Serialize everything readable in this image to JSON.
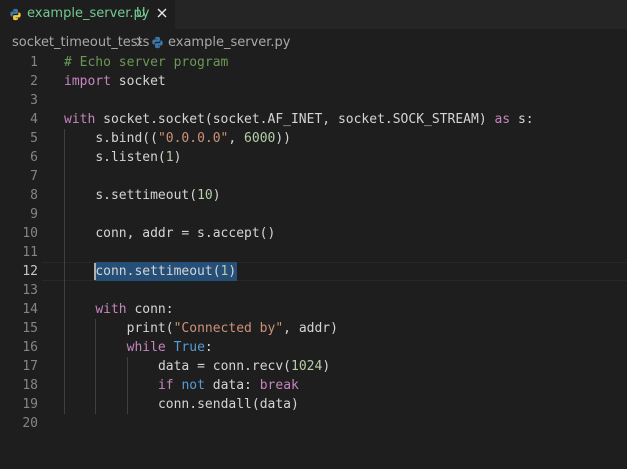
{
  "colors": {
    "editor_background": "#1e1e1e",
    "tab_label_untracked": "#73c991",
    "comment": "#6a9955",
    "keyword": "#c586c0",
    "constant": "#569cd6",
    "string": "#ce9178",
    "number": "#b5cea8",
    "selection": "#264f78"
  },
  "tab": {
    "label": "example_server.py",
    "status": "U",
    "icon": "python-file-icon",
    "close_icon": "close-icon"
  },
  "breadcrumb": {
    "folder": "socket_timeout_tests",
    "separator_icon": "chevron-right-icon",
    "file": "example_server.py",
    "file_icon": "python-file-icon"
  },
  "editor": {
    "active_line": 12,
    "lines": [
      {
        "number": "1",
        "indent": 0,
        "tokens": [
          {
            "t": "# Echo server program",
            "c": "comment"
          }
        ]
      },
      {
        "number": "2",
        "indent": 0,
        "tokens": [
          {
            "t": "import",
            "c": "keyword"
          },
          {
            "t": " socket",
            "c": "plain"
          }
        ]
      },
      {
        "number": "3",
        "indent": 0,
        "tokens": []
      },
      {
        "number": "4",
        "indent": 0,
        "tokens": [
          {
            "t": "with",
            "c": "keyword"
          },
          {
            "t": " socket.socket(socket.AF_INET, socket.SOCK_STREAM) ",
            "c": "plain"
          },
          {
            "t": "as",
            "c": "keyword"
          },
          {
            "t": " s:",
            "c": "plain"
          }
        ]
      },
      {
        "number": "5",
        "indent": 1,
        "tokens": [
          {
            "t": "s.bind((",
            "c": "plain"
          },
          {
            "t": "\"0.0.0.0\"",
            "c": "string"
          },
          {
            "t": ", ",
            "c": "plain"
          },
          {
            "t": "6000",
            "c": "number"
          },
          {
            "t": "))",
            "c": "plain"
          }
        ]
      },
      {
        "number": "6",
        "indent": 1,
        "tokens": [
          {
            "t": "s.listen(",
            "c": "plain"
          },
          {
            "t": "1",
            "c": "number"
          },
          {
            "t": ")",
            "c": "plain"
          }
        ]
      },
      {
        "number": "7",
        "indent": 1,
        "tokens": []
      },
      {
        "number": "8",
        "indent": 1,
        "tokens": [
          {
            "t": "s.settimeout(",
            "c": "plain"
          },
          {
            "t": "10",
            "c": "number"
          },
          {
            "t": ")",
            "c": "plain"
          }
        ]
      },
      {
        "number": "9",
        "indent": 1,
        "tokens": []
      },
      {
        "number": "10",
        "indent": 1,
        "tokens": [
          {
            "t": "conn, addr = s.accept()",
            "c": "plain"
          }
        ]
      },
      {
        "number": "11",
        "indent": 1,
        "tokens": []
      },
      {
        "number": "12",
        "indent": 1,
        "selected": true,
        "tokens": [
          {
            "t": "conn.settimeout(",
            "c": "plain"
          },
          {
            "t": "1",
            "c": "number"
          },
          {
            "t": ")",
            "c": "plain"
          }
        ]
      },
      {
        "number": "13",
        "indent": 1,
        "tokens": []
      },
      {
        "number": "14",
        "indent": 1,
        "tokens": [
          {
            "t": "with",
            "c": "keyword"
          },
          {
            "t": " conn:",
            "c": "plain"
          }
        ]
      },
      {
        "number": "15",
        "indent": 2,
        "tokens": [
          {
            "t": "print(",
            "c": "plain"
          },
          {
            "t": "\"Connected by\"",
            "c": "string"
          },
          {
            "t": ", addr)",
            "c": "plain"
          }
        ]
      },
      {
        "number": "16",
        "indent": 2,
        "tokens": [
          {
            "t": "while",
            "c": "keyword"
          },
          {
            "t": " ",
            "c": "plain"
          },
          {
            "t": "True",
            "c": "blue"
          },
          {
            "t": ":",
            "c": "plain"
          }
        ]
      },
      {
        "number": "17",
        "indent": 3,
        "tokens": [
          {
            "t": "data = conn.recv(",
            "c": "plain"
          },
          {
            "t": "1024",
            "c": "number"
          },
          {
            "t": ")",
            "c": "plain"
          }
        ]
      },
      {
        "number": "18",
        "indent": 3,
        "tokens": [
          {
            "t": "if",
            "c": "keyword"
          },
          {
            "t": " ",
            "c": "plain"
          },
          {
            "t": "not",
            "c": "blue"
          },
          {
            "t": " data: ",
            "c": "plain"
          },
          {
            "t": "break",
            "c": "keyword"
          }
        ]
      },
      {
        "number": "19",
        "indent": 3,
        "tokens": [
          {
            "t": "conn.sendall(data)",
            "c": "plain"
          }
        ]
      },
      {
        "number": "20",
        "indent": 0,
        "tokens": []
      }
    ]
  }
}
